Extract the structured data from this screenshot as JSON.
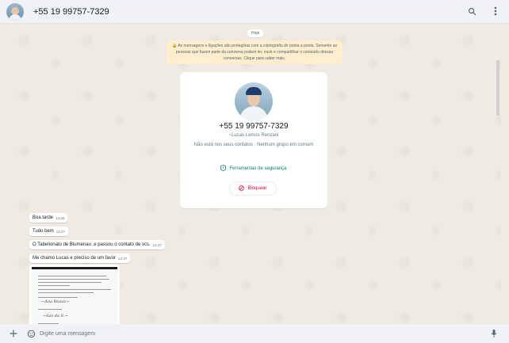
{
  "header": {
    "title": "+55 19 99757-7329",
    "icons": [
      "search-icon",
      "menu-icon"
    ]
  },
  "chat": {
    "day_chip": "Hoje",
    "encryption_notice": "🔒 As mensagens e ligações são protegidas com a criptografia de ponta a ponta. Somente as pessoas que fazem parte da conversa podem ler, ouvir e compartilhar o conteúdo dessas conversas. Clique para saber mais.",
    "contact_card": {
      "phone": "+55 19 99757-7329",
      "name": "~Lucas Lemos Renzani",
      "info": "Não está nos seus contatos · Nenhum grupo em comum",
      "safety_tools": "Ferramentas de segurança",
      "block": "Bloquear"
    },
    "messages": [
      {
        "text": "Boa tarde",
        "time": "14:46"
      },
      {
        "text": "Tudo bem",
        "time": "14:47"
      },
      {
        "text": "O Tabelionato de Blumenau .e passou o contato de vcs.",
        "time": "14:47"
      },
      {
        "text": "Me chamo Lucas e preciso de um favor",
        "time": "14:47"
      }
    ]
  },
  "composer": {
    "placeholder": "Digite uma mensagem",
    "icons": [
      "plus-icon",
      "sticker-icon",
      "mic-icon"
    ]
  },
  "colors": {
    "header_bg": "#f0f2f5",
    "chat_bg": "#efeae2",
    "encryption_bg": "#ffeecd",
    "accent_green": "#008069",
    "block_red": "#ea0038"
  }
}
